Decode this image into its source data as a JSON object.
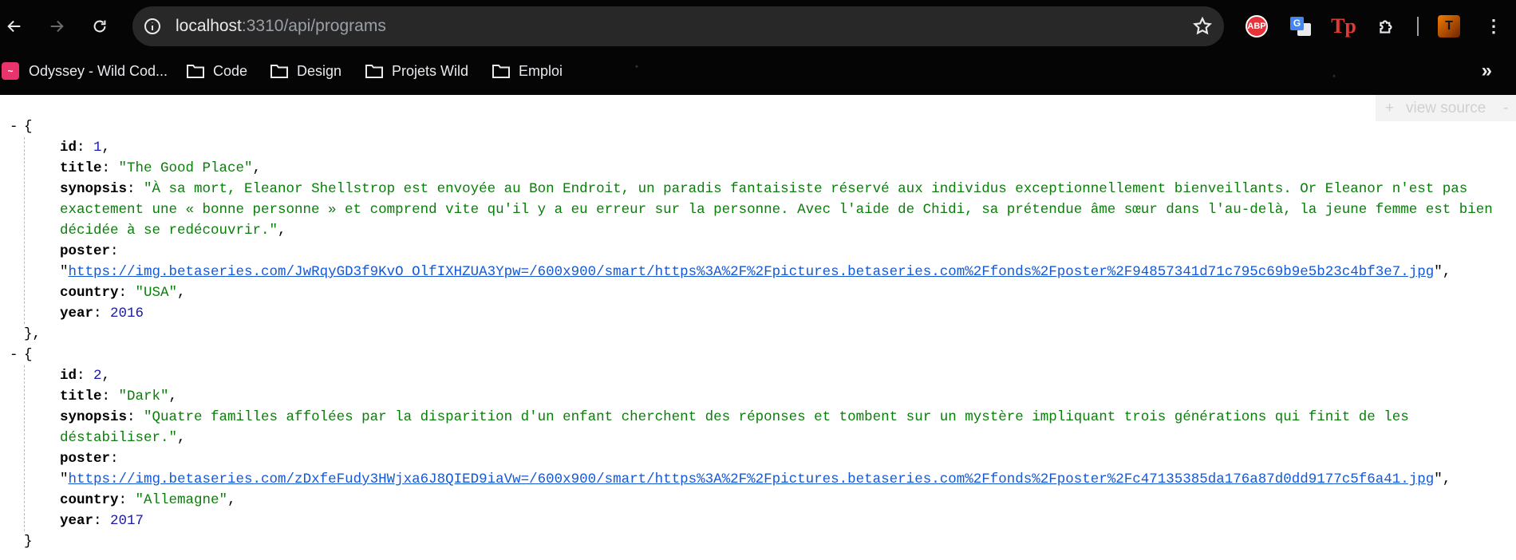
{
  "browser": {
    "url_host": "localhost",
    "url_path": ":3310/api/programs",
    "bookmarks": [
      "Odyssey - Wild Cod...",
      "Code",
      "Design",
      "Projets Wild",
      "Emploi"
    ],
    "extensions": [
      "ABP",
      "Google Translate",
      "Tp"
    ],
    "icons": [
      "back-icon",
      "forward-icon",
      "reload-icon",
      "site-info-icon",
      "star-icon",
      "puzzle-icon",
      "kebab-menu-icon",
      "chevron-double-right-icon",
      "folder-icon"
    ]
  },
  "viewer": {
    "view_source_label": "view source",
    "plus": "+",
    "minus": "-"
  },
  "json": {
    "collapse": "-",
    "open": "{",
    "close": "}",
    "close_comma": "},",
    "quote": "\"",
    "comma": ",",
    "items": [
      {
        "id": "1",
        "title": "\"The Good Place\"",
        "synopsis": "\"À sa mort, Eleanor Shellstrop est envoyée au Bon Endroit, un paradis fantaisiste réservé aux individus exceptionnellement bienveillants. Or Eleanor n'est pas exactement une « bonne personne » et comprend vite qu'il y a eu erreur sur la personne. Avec l'aide de Chidi, sa prétendue âme sœur dans l'au-delà, la jeune femme est bien décidée à se redécouvrir.\"",
        "poster": "https://img.betaseries.com/JwRqyGD3f9KvO_OlfIXHZUA3Ypw=/600x900/smart/https%3A%2F%2Fpictures.betaseries.com%2Ffonds%2Fposter%2F94857341d71c795c69b9e5b23c4bf3e7.jpg",
        "country": "\"USA\"",
        "year": "2016"
      },
      {
        "id": "2",
        "title": "\"Dark\"",
        "synopsis": "\"Quatre familles affolées par la disparition d'un enfant cherchent des réponses et tombent sur un mystère impliquant trois générations qui finit de les déstabiliser.\"",
        "poster": "https://img.betaseries.com/zDxfeFudy3HWjxa6J8QIED9iaVw=/600x900/smart/https%3A%2F%2Fpictures.betaseries.com%2Ffonds%2Fposter%2Fc47135385da176a87d0dd9177c5f6a41.jpg",
        "country": "\"Allemagne\"",
        "year": "2017"
      }
    ],
    "keys": {
      "id": "id",
      "title": "title",
      "synopsis": "synopsis",
      "poster": "poster",
      "country": "country",
      "year": "year"
    }
  }
}
